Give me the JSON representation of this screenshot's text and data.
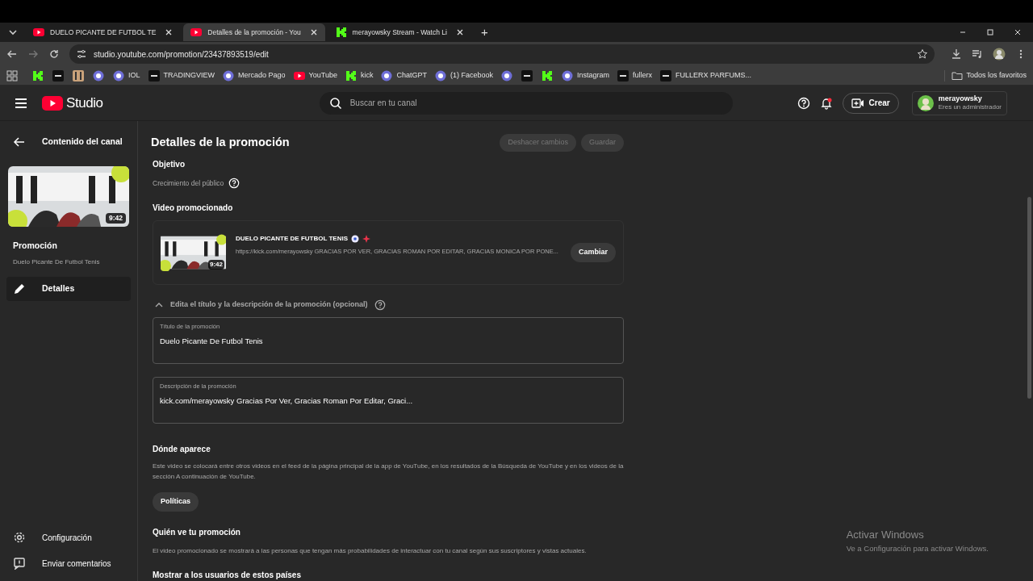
{
  "browser": {
    "tabs": [
      {
        "title": "DUELO PICANTE DE FUTBOL TE",
        "kind": "youtube",
        "selected": false
      },
      {
        "title": "Detalles de la promoción - You",
        "kind": "youtube",
        "selected": true
      },
      {
        "title": "merayowsky Stream - Watch Li",
        "kind": "kick",
        "selected": false
      }
    ],
    "new_tab": "+",
    "url": "studio.youtube.com/promotion/23437893519/edit",
    "bookmarks": [
      {
        "kind": "kick"
      },
      {
        "kind": "dark"
      },
      {
        "kind": "bars"
      },
      {
        "kind": "circle"
      },
      {
        "kind": "circle",
        "label": "IOL"
      },
      {
        "kind": "dark",
        "label": "TRADINGVIEW"
      },
      {
        "kind": "circle",
        "label": "Mercado Pago"
      },
      {
        "kind": "youtube",
        "label": "YouTube"
      },
      {
        "kind": "kick",
        "label": "kick"
      },
      {
        "kind": "circle",
        "label": "ChatGPT"
      },
      {
        "kind": "circle",
        "label": "(1) Facebook"
      },
      {
        "kind": "circle"
      },
      {
        "kind": "dark"
      },
      {
        "kind": "kick"
      },
      {
        "kind": "circle",
        "label": "Instagram"
      },
      {
        "kind": "dark",
        "label": "fullerx"
      },
      {
        "kind": "dark",
        "label": "FULLERX PARFUMS..."
      }
    ],
    "all_bookmarks": "Todos los favoritos"
  },
  "header": {
    "logo": "Studio",
    "search": {
      "placeholder": "Buscar en tu canal"
    },
    "create": "Crear",
    "account": {
      "name": "merayowsky",
      "role": "Eres un administrador"
    }
  },
  "sidebar": {
    "back": "Contenido del canal",
    "thumbnail_duration": "9:42",
    "title": "Promoción",
    "subtitle": "Duelo Picante De Futbol Tenis",
    "items": [
      {
        "label": "Detalles",
        "selected": true
      }
    ],
    "footer": [
      {
        "label": "Configuración",
        "kind": "settings"
      },
      {
        "label": "Enviar comentarios",
        "kind": "feedback"
      }
    ]
  },
  "main": {
    "title": "Detalles de la promoción",
    "actions": [
      {
        "label": "Deshacer cambios",
        "disabled": true
      },
      {
        "label": "Guardar",
        "disabled": true
      }
    ],
    "objective": {
      "heading": "Objetivo",
      "value": "Crecimiento del público"
    },
    "video": {
      "heading": "Video promocionado",
      "title": "DUELO PICANTE DE FUTBOL TENIS",
      "description": "https://kick.com/merayowsky GRACIAS POR VER, GRACIAS ROMAN POR EDITAR, GRACIAS MONICA POR PONE...",
      "duration": "9:42",
      "button": "Cambiar"
    },
    "edit_toggle": {
      "label": "Edita el título y la descripción de la promoción (opcional)",
      "expanded": true
    },
    "fields": [
      {
        "label": "Título de la promoción",
        "value": "Duelo Picante De Futbol Tenis"
      },
      {
        "label": "Descripción de la promoción",
        "value": "kick.com/merayowsky Gracias Por Ver, Gracias Roman Por Editar, Graci..."
      }
    ],
    "where": {
      "heading": "Dónde aparece",
      "text": "Este video se colocará entre otros videos en el feed de la página principal de la app de YouTube, en los resultados de la Búsqueda de YouTube y en los videos de la sección A continuación de YouTube.",
      "button": "Políticas"
    },
    "who": {
      "heading": "Quién ve tu promoción",
      "text": "El video promocionado se mostrará a las personas que tengan más probabilidades de interactuar con tu canal según sus suscriptores y vistas actuales."
    },
    "countries": {
      "heading": "Mostrar a los usuarios de estos países"
    }
  },
  "os_notice": {
    "title": "Activar Windows",
    "text": "Ve a Configuración para activar Windows."
  }
}
